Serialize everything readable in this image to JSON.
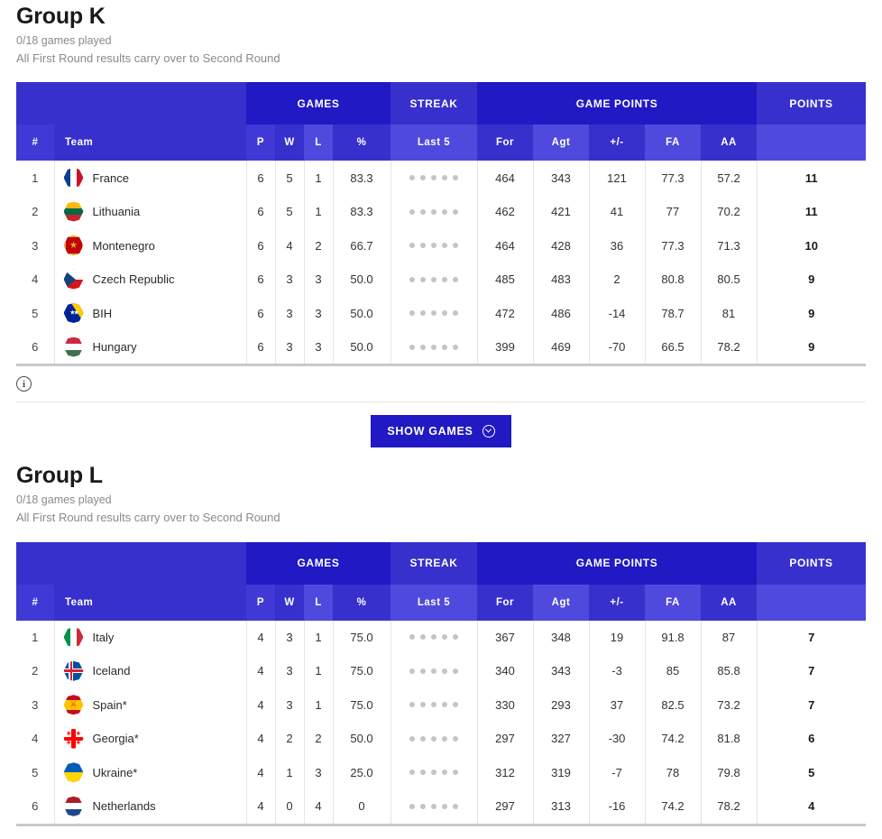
{
  "groups": [
    {
      "title": "Group K",
      "games_played": "0/18 games played",
      "note": "All First Round results carry over to Second Round",
      "header_groups": [
        {
          "label": "",
          "span": 2,
          "tone": "light"
        },
        {
          "label": "GAMES",
          "span": 4,
          "tone": "dark"
        },
        {
          "label": "STREAK",
          "span": 1,
          "tone": "light"
        },
        {
          "label": "GAME POINTS",
          "span": 5,
          "tone": "dark"
        },
        {
          "label": "POINTS",
          "span": 1,
          "tone": "light"
        }
      ],
      "columns": [
        "#",
        "Team",
        "P",
        "W",
        "L",
        "%",
        "Last 5",
        "For",
        "Agt",
        "+/-",
        "FA",
        "AA",
        ""
      ],
      "rows": [
        {
          "rank": "1",
          "team": "France",
          "flag": "flag-france",
          "p": "6",
          "w": "5",
          "l": "1",
          "pct": "83.3",
          "streak": 5,
          "for": "464",
          "agt": "343",
          "diff": "121",
          "fa": "77.3",
          "aa": "57.2",
          "points": "11"
        },
        {
          "rank": "2",
          "team": "Lithuania",
          "flag": "flag-lithuania",
          "p": "6",
          "w": "5",
          "l": "1",
          "pct": "83.3",
          "streak": 5,
          "for": "462",
          "agt": "421",
          "diff": "41",
          "fa": "77",
          "aa": "70.2",
          "points": "11"
        },
        {
          "rank": "3",
          "team": "Montenegro",
          "flag": "flag-montenegro",
          "p": "6",
          "w": "4",
          "l": "2",
          "pct": "66.7",
          "streak": 5,
          "for": "464",
          "agt": "428",
          "diff": "36",
          "fa": "77.3",
          "aa": "71.3",
          "points": "10"
        },
        {
          "rank": "4",
          "team": "Czech Republic",
          "flag": "flag-czech",
          "p": "6",
          "w": "3",
          "l": "3",
          "pct": "50.0",
          "streak": 5,
          "for": "485",
          "agt": "483",
          "diff": "2",
          "fa": "80.8",
          "aa": "80.5",
          "points": "9"
        },
        {
          "rank": "5",
          "team": "BIH",
          "flag": "flag-bih",
          "p": "6",
          "w": "3",
          "l": "3",
          "pct": "50.0",
          "streak": 5,
          "for": "472",
          "agt": "486",
          "diff": "-14",
          "fa": "78.7",
          "aa": "81",
          "points": "9"
        },
        {
          "rank": "6",
          "team": "Hungary",
          "flag": "flag-hungary",
          "p": "6",
          "w": "3",
          "l": "3",
          "pct": "50.0",
          "streak": 5,
          "for": "399",
          "agt": "469",
          "diff": "-70",
          "fa": "66.5",
          "aa": "78.2",
          "points": "9"
        }
      ],
      "info_icon": "info-circle-icon",
      "show_games_label": "SHOW GAMES",
      "show_games_icon": "chevron-down-circle-icon",
      "has_footer": true
    },
    {
      "title": "Group L",
      "games_played": "0/18 games played",
      "note": "All First Round results carry over to Second Round",
      "header_groups": [
        {
          "label": "",
          "span": 2,
          "tone": "light"
        },
        {
          "label": "GAMES",
          "span": 4,
          "tone": "dark"
        },
        {
          "label": "STREAK",
          "span": 1,
          "tone": "light"
        },
        {
          "label": "GAME POINTS",
          "span": 5,
          "tone": "dark"
        },
        {
          "label": "POINTS",
          "span": 1,
          "tone": "light"
        }
      ],
      "columns": [
        "#",
        "Team",
        "P",
        "W",
        "L",
        "%",
        "Last 5",
        "For",
        "Agt",
        "+/-",
        "FA",
        "AA",
        ""
      ],
      "rows": [
        {
          "rank": "1",
          "team": "Italy",
          "flag": "flag-italy",
          "p": "4",
          "w": "3",
          "l": "1",
          "pct": "75.0",
          "streak": 5,
          "for": "367",
          "agt": "348",
          "diff": "19",
          "fa": "91.8",
          "aa": "87",
          "points": "7"
        },
        {
          "rank": "2",
          "team": "Iceland",
          "flag": "flag-iceland",
          "p": "4",
          "w": "3",
          "l": "1",
          "pct": "75.0",
          "streak": 5,
          "for": "340",
          "agt": "343",
          "diff": "-3",
          "fa": "85",
          "aa": "85.8",
          "points": "7"
        },
        {
          "rank": "3",
          "team": "Spain*",
          "flag": "flag-spain",
          "p": "4",
          "w": "3",
          "l": "1",
          "pct": "75.0",
          "streak": 5,
          "for": "330",
          "agt": "293",
          "diff": "37",
          "fa": "82.5",
          "aa": "73.2",
          "points": "7"
        },
        {
          "rank": "4",
          "team": "Georgia*",
          "flag": "flag-georgia",
          "p": "4",
          "w": "2",
          "l": "2",
          "pct": "50.0",
          "streak": 5,
          "for": "297",
          "agt": "327",
          "diff": "-30",
          "fa": "74.2",
          "aa": "81.8",
          "points": "6"
        },
        {
          "rank": "5",
          "team": "Ukraine*",
          "flag": "flag-ukraine",
          "p": "4",
          "w": "1",
          "l": "3",
          "pct": "25.0",
          "streak": 5,
          "for": "312",
          "agt": "319",
          "diff": "-7",
          "fa": "78",
          "aa": "79.8",
          "points": "5"
        },
        {
          "rank": "6",
          "team": "Netherlands",
          "flag": "flag-netherlands",
          "p": "4",
          "w": "0",
          "l": "4",
          "pct": "0",
          "streak": 5,
          "for": "297",
          "agt": "313",
          "diff": "-16",
          "fa": "74.2",
          "aa": "78.2",
          "points": "4"
        }
      ],
      "has_footer": false
    }
  ],
  "colors": {
    "header_dark": "#2019c4",
    "header_light": "#3730cc",
    "subheader_a": "#4039d6",
    "subheader_b": "#3730cc",
    "subheader_c": "#5049dd",
    "dot": "#c4c4c4",
    "muted_text": "#8a8a8a"
  }
}
